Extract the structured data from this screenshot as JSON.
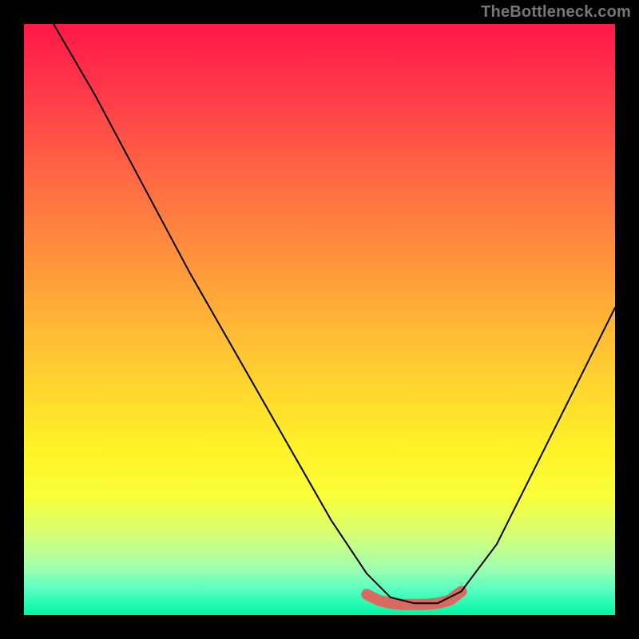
{
  "watermark": "TheBottleneck.com",
  "chart_data": {
    "type": "line",
    "title": "",
    "xlabel": "",
    "ylabel": "",
    "xlim": [
      0,
      1
    ],
    "ylim": [
      0,
      1
    ],
    "grid": false,
    "legend": false,
    "background_gradient_stops": [
      {
        "pos": 0.0,
        "color": "#ff1846"
      },
      {
        "pos": 0.12,
        "color": "#ff3a4a"
      },
      {
        "pos": 0.25,
        "color": "#ff6644"
      },
      {
        "pos": 0.37,
        "color": "#ff8a3e"
      },
      {
        "pos": 0.5,
        "color": "#ffb436"
      },
      {
        "pos": 0.62,
        "color": "#ffd82e"
      },
      {
        "pos": 0.72,
        "color": "#fff227"
      },
      {
        "pos": 0.8,
        "color": "#f9ff3a"
      },
      {
        "pos": 0.86,
        "color": "#d8ff70"
      },
      {
        "pos": 0.92,
        "color": "#a0ffb0"
      },
      {
        "pos": 0.96,
        "color": "#50ffc0"
      },
      {
        "pos": 1.0,
        "color": "#00f5a4"
      }
    ],
    "series": [
      {
        "name": "curve",
        "color": "#000000",
        "stroke_width": 2,
        "x": [
          0.05,
          0.12,
          0.2,
          0.28,
          0.36,
          0.44,
          0.52,
          0.58,
          0.62,
          0.66,
          0.7,
          0.74,
          0.8,
          0.88,
          0.96,
          1.0
        ],
        "y": [
          1.0,
          0.88,
          0.73,
          0.58,
          0.44,
          0.3,
          0.16,
          0.07,
          0.03,
          0.02,
          0.02,
          0.04,
          0.12,
          0.28,
          0.44,
          0.52
        ]
      },
      {
        "name": "highlight-band",
        "color": "#d86a62",
        "stroke_width": 14,
        "x": [
          0.58,
          0.6,
          0.62,
          0.64,
          0.66,
          0.68,
          0.7,
          0.72,
          0.74
        ],
        "y": [
          0.035,
          0.025,
          0.02,
          0.018,
          0.018,
          0.018,
          0.02,
          0.025,
          0.04
        ]
      }
    ]
  }
}
